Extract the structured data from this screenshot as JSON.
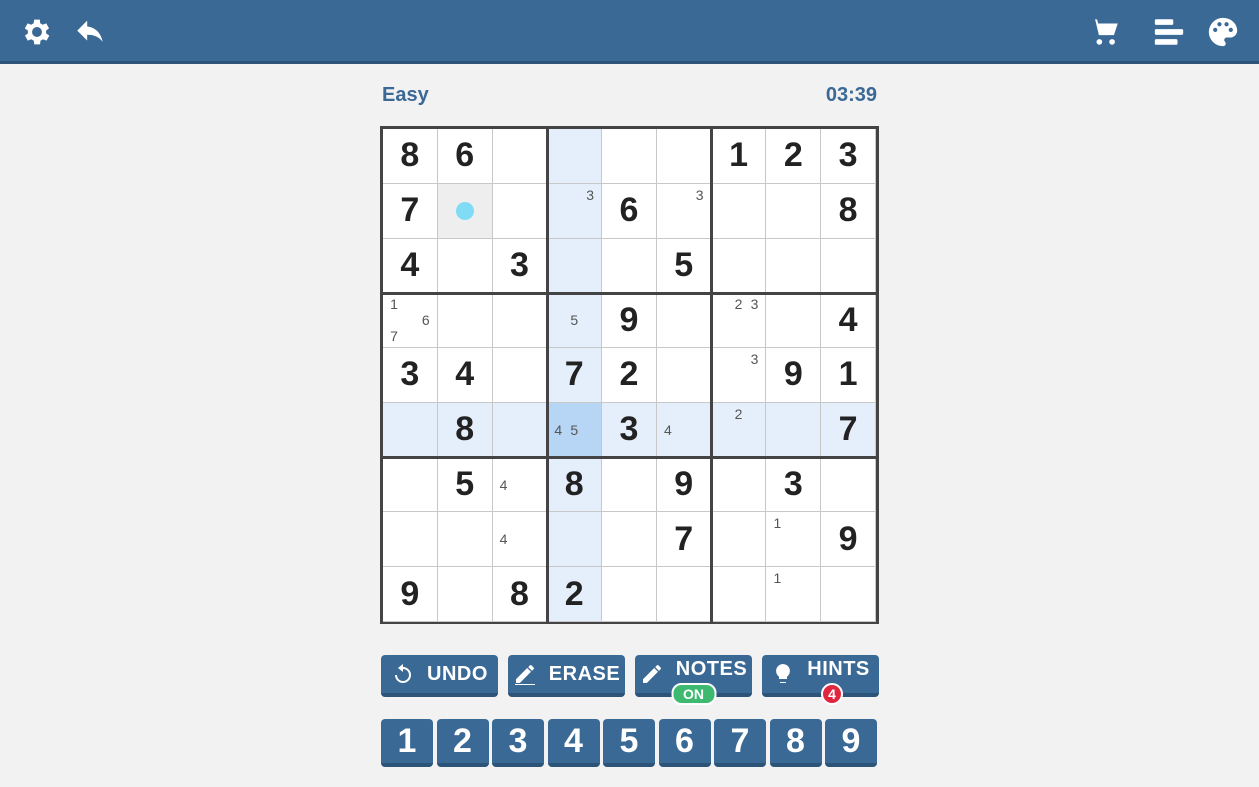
{
  "header": {
    "icons": [
      "gear-icon",
      "back-arrow-icon",
      "cart-icon",
      "bar-chart-icon",
      "palette-icon"
    ]
  },
  "game": {
    "level": "Easy",
    "timer": "03:39"
  },
  "board": {
    "values": [
      [
        8,
        6,
        0,
        0,
        0,
        0,
        1,
        2,
        3
      ],
      [
        7,
        0,
        0,
        0,
        6,
        0,
        0,
        0,
        8
      ],
      [
        4,
        0,
        3,
        0,
        0,
        5,
        0,
        0,
        0
      ],
      [
        0,
        0,
        0,
        0,
        9,
        0,
        0,
        0,
        4
      ],
      [
        3,
        4,
        0,
        7,
        2,
        0,
        0,
        9,
        1
      ],
      [
        0,
        8,
        0,
        0,
        3,
        0,
        0,
        0,
        7
      ],
      [
        0,
        5,
        0,
        8,
        0,
        9,
        0,
        3,
        0
      ],
      [
        0,
        0,
        0,
        0,
        0,
        7,
        0,
        0,
        9
      ],
      [
        9,
        0,
        8,
        2,
        0,
        0,
        0,
        0,
        0
      ]
    ],
    "notes": {
      "1,3": [
        3
      ],
      "1,5": [
        3
      ],
      "3,0": [
        1,
        6,
        7
      ],
      "3,3": [
        5
      ],
      "3,6": [
        2,
        3
      ],
      "4,6": [
        3
      ],
      "5,3": [
        4,
        5
      ],
      "5,5": [
        4
      ],
      "5,6": [
        2
      ],
      "6,2": [
        4
      ],
      "7,2": [
        4
      ],
      "7,7": [
        1
      ],
      "8,7": [
        1
      ]
    },
    "selected": [
      1,
      1
    ],
    "highlight_row": 5,
    "highlight_col": 3,
    "highlight_strong": [
      5,
      3
    ]
  },
  "actions": {
    "undo": "UNDO",
    "erase": "ERASE",
    "notes": "NOTES",
    "notes_state": "ON",
    "hints": "HINTS",
    "hints_count": "4"
  },
  "numpad": [
    "1",
    "2",
    "3",
    "4",
    "5",
    "6",
    "7",
    "8",
    "9"
  ]
}
